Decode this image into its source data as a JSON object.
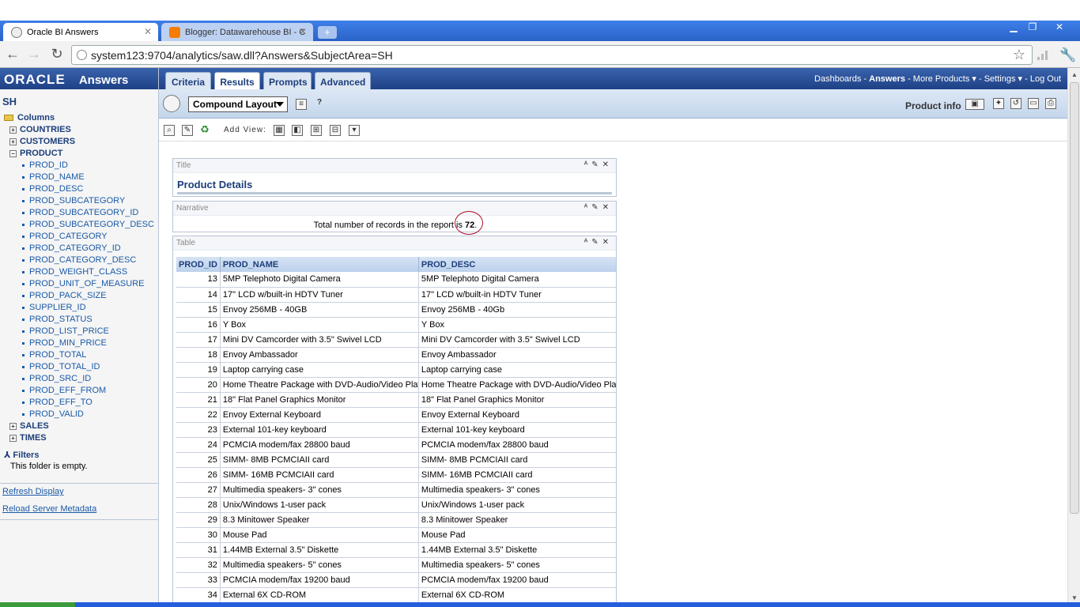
{
  "browser": {
    "tabs": [
      {
        "label": "Oracle BI Answers"
      },
      {
        "label": "Blogger: Datawarehouse BI - C"
      }
    ],
    "url": "system123:9704/analytics/saw.dll?Answers&SubjectArea=SH"
  },
  "app": {
    "logo": "ORACLE",
    "name": "Answers",
    "subject_area": "SH"
  },
  "left_pane": {
    "columns_label": "Columns",
    "folders_top": [
      {
        "label": "COUNTRIES",
        "expander": "+"
      },
      {
        "label": "CUSTOMERS",
        "expander": "+"
      },
      {
        "label": "PRODUCT",
        "expander": "−"
      }
    ],
    "product_columns": [
      "PROD_ID",
      "PROD_NAME",
      "PROD_DESC",
      "PROD_SUBCATEGORY",
      "PROD_SUBCATEGORY_ID",
      "PROD_SUBCATEGORY_DESC",
      "PROD_CATEGORY",
      "PROD_CATEGORY_ID",
      "PROD_CATEGORY_DESC",
      "PROD_WEIGHT_CLASS",
      "PROD_UNIT_OF_MEASURE",
      "PROD_PACK_SIZE",
      "SUPPLIER_ID",
      "PROD_STATUS",
      "PROD_LIST_PRICE",
      "PROD_MIN_PRICE",
      "PROD_TOTAL",
      "PROD_TOTAL_ID",
      "PROD_SRC_ID",
      "PROD_EFF_FROM",
      "PROD_EFF_TO",
      "PROD_VALID"
    ],
    "folders_bottom": [
      {
        "label": "SALES",
        "expander": "+"
      },
      {
        "label": "TIMES",
        "expander": "+"
      }
    ],
    "filters_label": "Filters",
    "filters_empty": "This folder is empty.",
    "refresh_link": "Refresh Display",
    "reload_link": "Reload Server Metadata"
  },
  "tabs": [
    {
      "label": "Criteria"
    },
    {
      "label": "Results"
    },
    {
      "label": "Prompts"
    },
    {
      "label": "Advanced"
    }
  ],
  "global_links": {
    "dashboards": "Dashboards",
    "answers": "Answers",
    "more_products": "More Products",
    "settings": "Settings",
    "logout": "Log Out",
    "sep": "-"
  },
  "toolbar": {
    "layout_select": "Compound Layout",
    "product_info": "Product info",
    "add_view": "Add View:"
  },
  "views": {
    "title_view": {
      "header": "Title",
      "title": "Product Details"
    },
    "narrative_view": {
      "header": "Narrative",
      "text_before": "Total number of records in the report is ",
      "count": "72",
      "text_after": "."
    },
    "table_view": {
      "header": "Table"
    }
  },
  "table": {
    "columns": [
      "PROD_ID",
      "PROD_NAME",
      "PROD_DESC"
    ],
    "rows": [
      [
        "13",
        "5MP Telephoto Digital Camera",
        "5MP Telephoto Digital Camera"
      ],
      [
        "14",
        "17\" LCD w/built-in HDTV Tuner",
        "17\" LCD w/built-in HDTV Tuner"
      ],
      [
        "15",
        "Envoy 256MB - 40GB",
        "Envoy 256MB - 40Gb"
      ],
      [
        "16",
        "Y Box",
        "Y Box"
      ],
      [
        "17",
        "Mini DV Camcorder with 3.5\" Swivel LCD",
        "Mini DV Camcorder with 3.5\" Swivel LCD"
      ],
      [
        "18",
        "Envoy Ambassador",
        "Envoy Ambassador"
      ],
      [
        "19",
        "Laptop carrying case",
        "Laptop carrying case"
      ],
      [
        "20",
        "Home Theatre Package with DVD-Audio/Video Play",
        "Home Theatre Package with DVD-Audio/Video Play"
      ],
      [
        "21",
        "18\" Flat Panel Graphics Monitor",
        "18\" Flat Panel Graphics Monitor"
      ],
      [
        "22",
        "Envoy External Keyboard",
        "Envoy External Keyboard"
      ],
      [
        "23",
        "External 101-key keyboard",
        "External 101-key keyboard"
      ],
      [
        "24",
        "PCMCIA modem/fax 28800 baud",
        "PCMCIA modem/fax 28800 baud"
      ],
      [
        "25",
        "SIMM- 8MB PCMCIAII card",
        "SIMM- 8MB PCMCIAII card"
      ],
      [
        "26",
        "SIMM- 16MB PCMCIAII card",
        "SIMM- 16MB PCMCIAII card"
      ],
      [
        "27",
        "Multimedia speakers- 3\" cones",
        "Multimedia speakers- 3\" cones"
      ],
      [
        "28",
        "Unix/Windows 1-user pack",
        "Unix/Windows 1-user pack"
      ],
      [
        "29",
        "8.3 Minitower Speaker",
        "8.3 Minitower Speaker"
      ],
      [
        "30",
        "Mouse Pad",
        "Mouse Pad"
      ],
      [
        "31",
        "1.44MB External 3.5\" Diskette",
        "1.44MB External 3.5\" Diskette"
      ],
      [
        "32",
        "Multimedia speakers- 5\" cones",
        "Multimedia speakers- 5\" cones"
      ],
      [
        "33",
        "PCMCIA modem/fax 19200 baud",
        "PCMCIA modem/fax 19200 baud"
      ],
      [
        "34",
        "External 6X CD-ROM",
        "External 6X CD-ROM"
      ]
    ]
  },
  "colors": {
    "header_blue": "#2a4f95",
    "link_blue": "#1a5aa8",
    "annotation_circle": "#b0102a"
  },
  "icons": {
    "back": "back-arrow-icon",
    "forward": "forward-arrow-icon",
    "reload": "reload-icon",
    "bookmark": "star-icon",
    "wrench": "wrench-icon"
  }
}
